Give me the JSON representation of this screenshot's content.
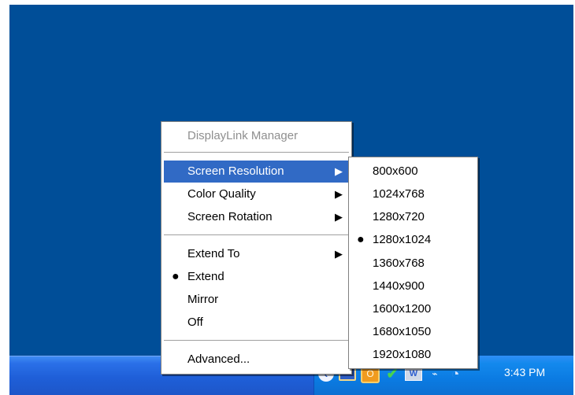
{
  "menu": {
    "title": "DisplayLink Manager",
    "items": [
      {
        "label": "Screen Resolution",
        "has_submenu": true,
        "highlighted": true,
        "selected": false
      },
      {
        "label": "Color Quality",
        "has_submenu": true,
        "highlighted": false,
        "selected": false
      },
      {
        "label": "Screen Rotation",
        "has_submenu": true,
        "highlighted": false,
        "selected": false
      },
      {
        "label": "Extend To",
        "has_submenu": true,
        "highlighted": false,
        "selected": false
      },
      {
        "label": "Extend",
        "has_submenu": false,
        "highlighted": false,
        "selected": true
      },
      {
        "label": "Mirror",
        "has_submenu": false,
        "highlighted": false,
        "selected": false
      },
      {
        "label": "Off",
        "has_submenu": false,
        "highlighted": false,
        "selected": false
      },
      {
        "label": "Advanced...",
        "has_submenu": false,
        "highlighted": false,
        "selected": false
      }
    ]
  },
  "submenu": {
    "items": [
      {
        "label": "800x600",
        "selected": false
      },
      {
        "label": "1024x768",
        "selected": false
      },
      {
        "label": "1280x720",
        "selected": false
      },
      {
        "label": "1280x1024",
        "selected": true
      },
      {
        "label": "1360x768",
        "selected": false
      },
      {
        "label": "1440x900",
        "selected": false
      },
      {
        "label": "1600x1200",
        "selected": false
      },
      {
        "label": "1680x1050",
        "selected": false
      },
      {
        "label": "1920x1080",
        "selected": false
      }
    ]
  },
  "taskbar": {
    "clock": "3:43 PM",
    "icons": [
      {
        "name": "back-arrow-icon",
        "glyph": "‹"
      },
      {
        "name": "monitor-icon",
        "glyph": ""
      },
      {
        "name": "orange-app-icon",
        "glyph": "O"
      },
      {
        "name": "check-icon",
        "glyph": "✔"
      },
      {
        "name": "network-icon",
        "glyph": "W"
      },
      {
        "name": "wireless-icon",
        "glyph": "⌁"
      },
      {
        "name": "speaker-icon",
        "glyph": "◔"
      }
    ]
  },
  "colors": {
    "desktop": "#004e98",
    "taskbar": "#245edb",
    "tray": "#0f84e8",
    "menu_highlight": "#316ac5",
    "menu_disabled": "#8f8f8f"
  }
}
